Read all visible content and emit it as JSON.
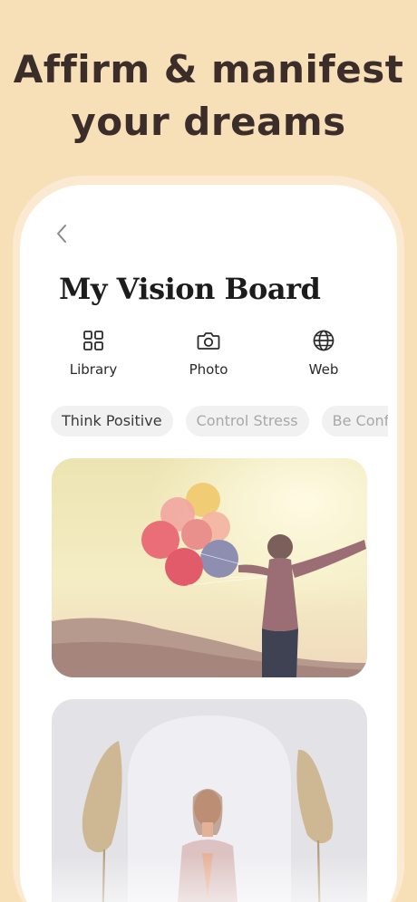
{
  "headline": {
    "line1": "Affirm & manifest",
    "line2": "your dreams"
  },
  "screen": {
    "title": "My Vision Board",
    "back_icon": "chevron-left-icon",
    "sources": [
      {
        "label": "Library",
        "icon": "grid-icon"
      },
      {
        "label": "Photo",
        "icon": "camera-icon"
      },
      {
        "label": "Web",
        "icon": "globe-icon"
      }
    ],
    "chips": [
      {
        "label": "Think Positive",
        "active": true
      },
      {
        "label": "Control Stress",
        "active": false
      },
      {
        "label": "Be Confident",
        "active": false
      }
    ],
    "cards": [
      {
        "name": "balloons-photo"
      },
      {
        "name": "meditation-photo"
      }
    ]
  },
  "colors": {
    "background": "#f7dfb8",
    "headline": "#3b2e2a",
    "title": "#1c1c1c",
    "chip_bg": "#f1f1f1"
  }
}
